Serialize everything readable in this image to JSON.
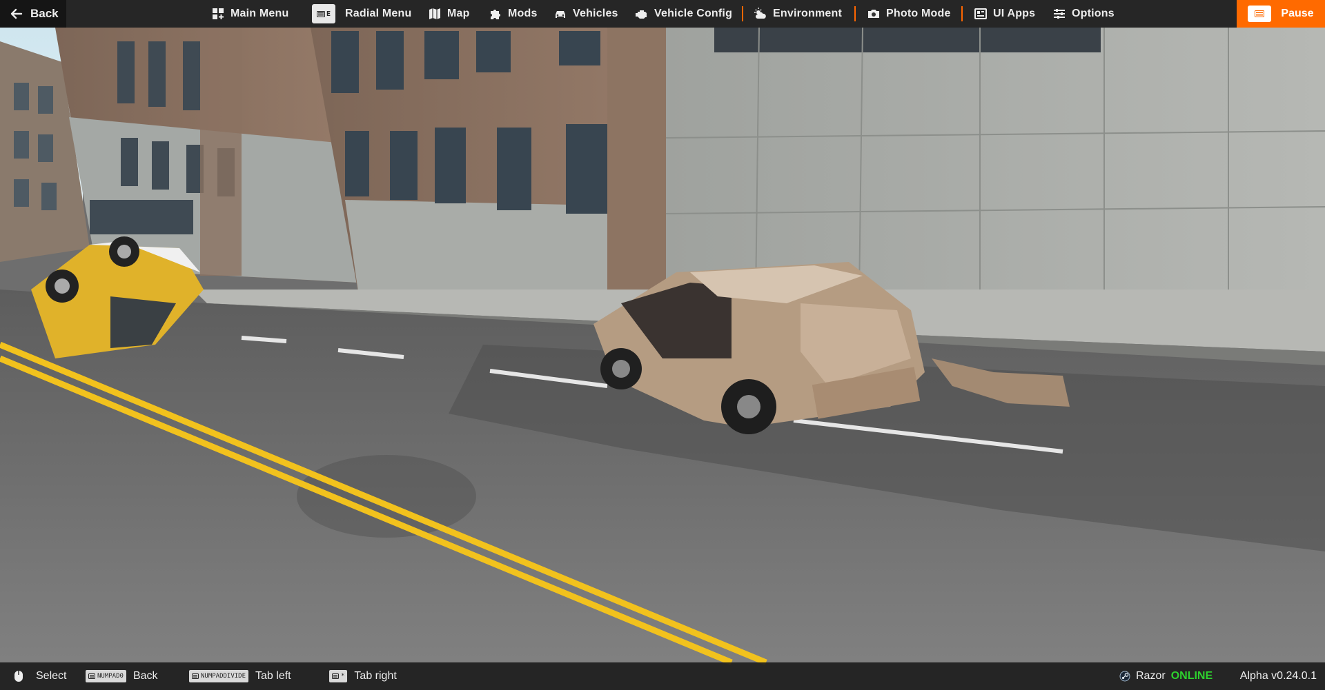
{
  "topbar": {
    "back_label": "Back",
    "items": [
      {
        "key": "main_menu",
        "label": "Main Menu",
        "icon": "main-menu-icon"
      },
      {
        "key": "radial_menu",
        "label": "Radial Menu",
        "icon": "keyboard-icon",
        "key_hint": "E"
      },
      {
        "key": "map",
        "label": "Map",
        "icon": "map-icon"
      },
      {
        "key": "mods",
        "label": "Mods",
        "icon": "puzzle-icon"
      },
      {
        "key": "vehicles",
        "label": "Vehicles",
        "icon": "car-icon"
      },
      {
        "key": "vehicle_config",
        "label": "Vehicle Config",
        "icon": "engine-icon"
      },
      {
        "key": "environment",
        "label": "Environment",
        "icon": "weather-icon"
      },
      {
        "key": "photo_mode",
        "label": "Photo Mode",
        "icon": "camera-icon"
      },
      {
        "key": "ui_apps",
        "label": "UI Apps",
        "icon": "apps-icon"
      },
      {
        "key": "options",
        "label": "Options",
        "icon": "sliders-icon"
      }
    ],
    "pause_label": "Pause",
    "accent_color": "#ff6a00"
  },
  "bottombar": {
    "hints": [
      {
        "key": "",
        "label": "Select",
        "icon": "mouse-icon"
      },
      {
        "key": "NUMPAD0",
        "label": "Back",
        "icon": "keyboard-icon"
      },
      {
        "key": "NUMPADDIVIDE",
        "label": "Tab left",
        "icon": "keyboard-icon"
      },
      {
        "key": "*",
        "label": "Tab right",
        "icon": "keyboard-icon"
      }
    ],
    "user": "Razor",
    "status": "ONLINE",
    "status_color": "#2ed12e",
    "version": "Alpha v0.24.0.1"
  }
}
